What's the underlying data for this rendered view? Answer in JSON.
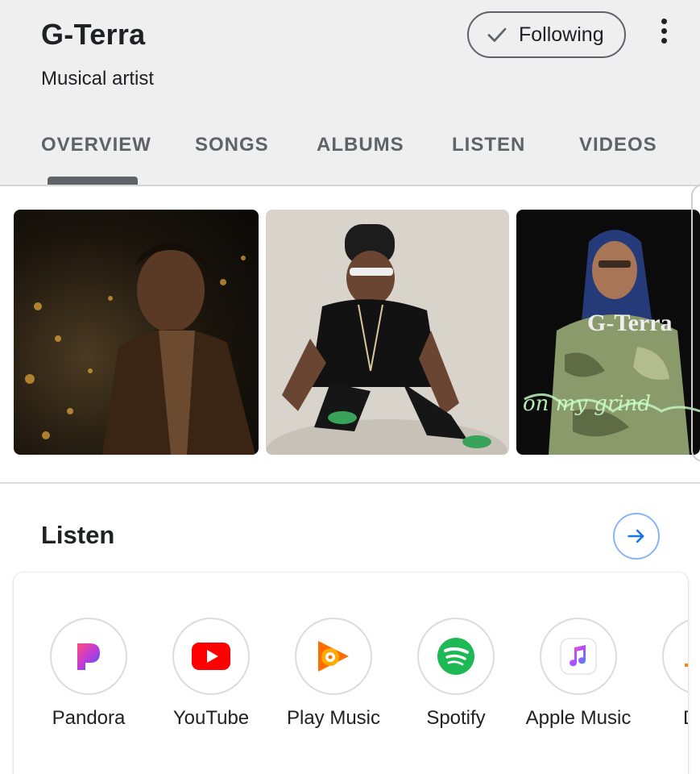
{
  "header": {
    "title": "G-Terra",
    "subtitle": "Musical artist",
    "follow_label": "Following"
  },
  "tabs": [
    {
      "label": "OVERVIEW",
      "active": true
    },
    {
      "label": "SONGS"
    },
    {
      "label": "ALBUMS"
    },
    {
      "label": "LISTEN"
    },
    {
      "label": "VIDEOS"
    }
  ],
  "photos": {
    "third_caption": "G-Terra",
    "third_script": "on my grind"
  },
  "listen": {
    "title": "Listen",
    "services": [
      {
        "name": "Pandora",
        "icon": "pandora-icon"
      },
      {
        "name": "YouTube",
        "icon": "youtube-icon"
      },
      {
        "name": "Play Music",
        "icon": "play-music-icon"
      },
      {
        "name": "Spotify",
        "icon": "spotify-icon"
      },
      {
        "name": "Apple Music",
        "icon": "apple-music-icon"
      },
      {
        "name": "Dee",
        "icon": "deezer-icon"
      }
    ]
  },
  "colors": {
    "header_bg": "#efefef",
    "accent_blue": "#1a73e8",
    "youtube_red": "#ff0000",
    "spotify_green": "#1db954"
  }
}
